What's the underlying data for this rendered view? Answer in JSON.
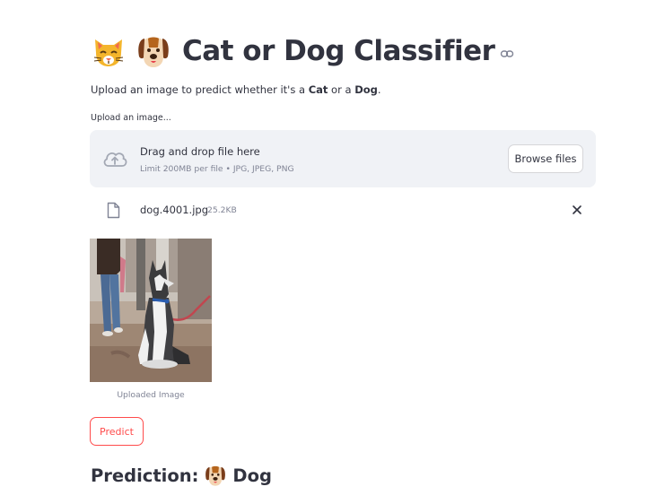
{
  "header": {
    "cat_emoji": "cat-face-emoji",
    "dog_emoji": "dog-face-emoji",
    "title": "Cat or Dog Classifier",
    "anchor_icon": "link-icon"
  },
  "intro": {
    "prefix": "Upload an image to predict whether it's a ",
    "cat": "Cat",
    "middle": " or a ",
    "dog": "Dog",
    "suffix": "."
  },
  "uploader": {
    "label": "Upload an image...",
    "drop_text": "Drag and drop file here",
    "limit_text": "Limit 200MB per file • JPG, JPEG, PNG",
    "browse_label": "Browse files",
    "icon": "cloud-upload-icon"
  },
  "uploaded_file": {
    "name": "dog.4001.jpg",
    "size": "25.2KB",
    "icon": "file-icon",
    "remove_icon": "close-icon"
  },
  "image": {
    "caption": "Uploaded Image"
  },
  "actions": {
    "predict_label": "Predict"
  },
  "result": {
    "label": "Prediction:",
    "emoji": "dog-face-emoji",
    "value": "Dog"
  },
  "colors": {
    "text": "#31333f",
    "muted": "#808495",
    "dropzone_bg": "#f0f2f6",
    "accent": "#ff4b4b"
  }
}
